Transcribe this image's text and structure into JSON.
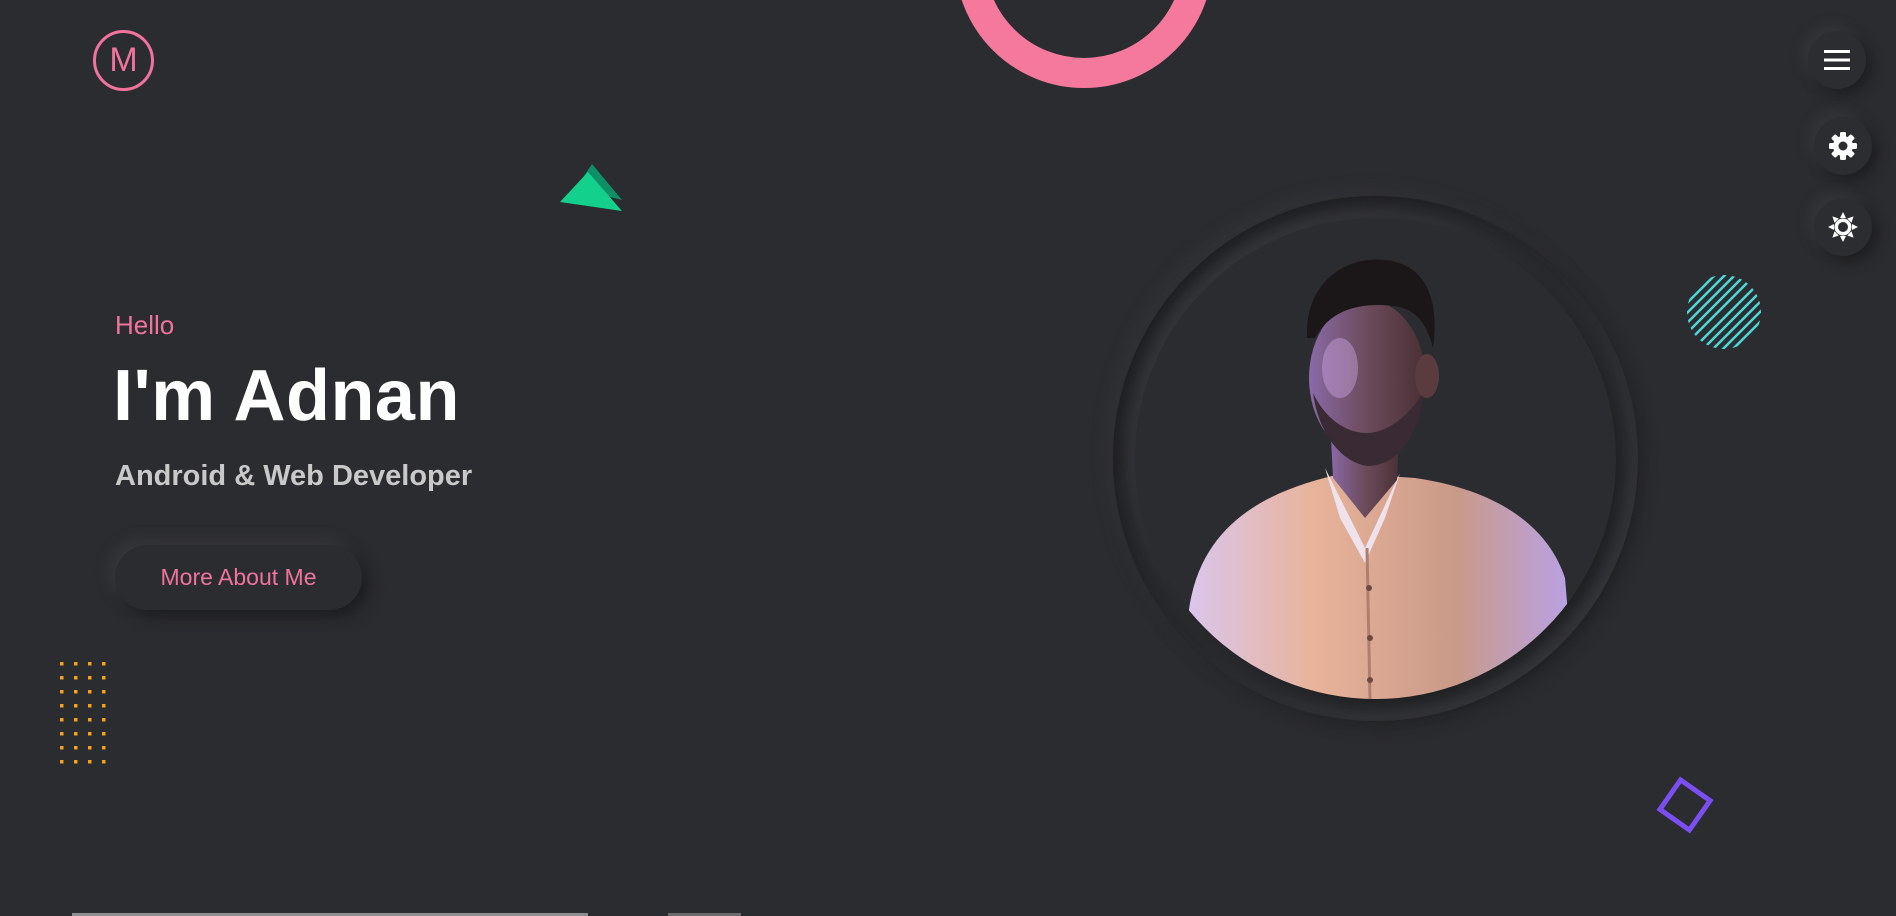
{
  "logo": {
    "letter": "M",
    "color": "#f0739c"
  },
  "hero": {
    "greeting": "Hello",
    "name": "I'm Adnan",
    "role": "Android & Web Developer",
    "cta_label": "More About Me"
  },
  "toolbar": {
    "menu_icon": "hamburger-menu-icon",
    "settings_icon": "gear-icon",
    "theme_icon": "sun-icon"
  },
  "colors": {
    "background": "#2b2c2f",
    "accent_pink": "#f0739c",
    "triangle_green": "#13d18c",
    "stripes_cyan": "#4fd6d8",
    "dots_orange": "#f3a21a",
    "diamond_purple": "#7a4ef0"
  }
}
